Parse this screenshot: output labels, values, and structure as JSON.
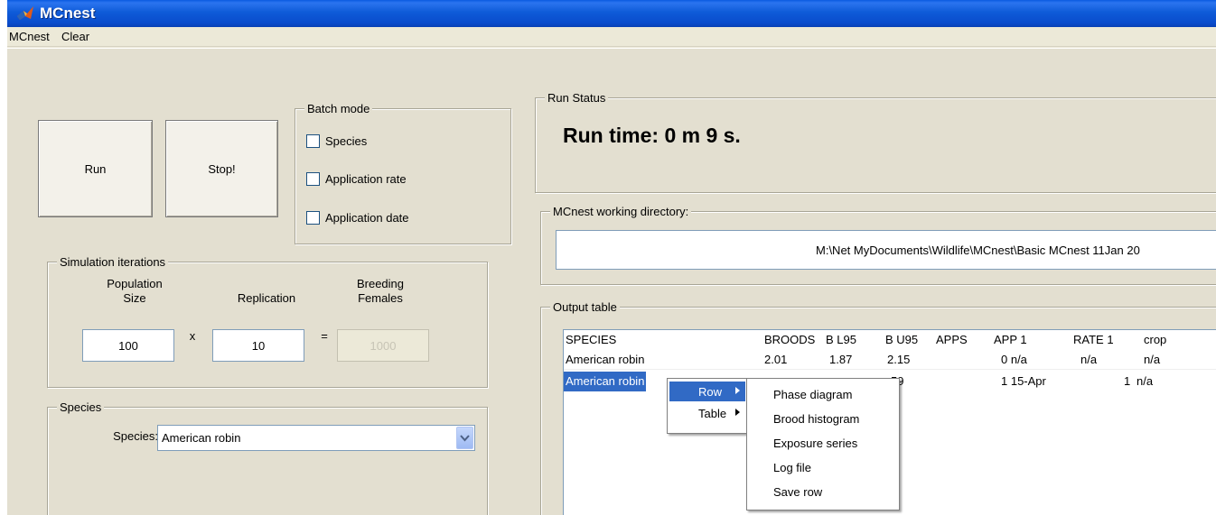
{
  "window": {
    "title": "MCnest"
  },
  "menu": [
    "MCnest",
    "Clear"
  ],
  "buttons": {
    "run": "Run",
    "stop": "Stop!"
  },
  "batch_mode": {
    "title": "Batch mode",
    "options": [
      {
        "label": "Species",
        "checked": false
      },
      {
        "label": "Application rate",
        "checked": false
      },
      {
        "label": "Application date",
        "checked": false
      }
    ]
  },
  "simulation": {
    "title": "Simulation iterations",
    "population_label": "Population\nSize",
    "population_label_lines": [
      "Population",
      "Size"
    ],
    "replication_label": "Replication",
    "breeding_label_lines": [
      "Breeding",
      "Females"
    ],
    "population_value": "100",
    "times_sign": "x",
    "replication_value": "10",
    "equals_sign": "=",
    "breeding_value": "1000"
  },
  "species_panel": {
    "title": "Species",
    "label": "Species:",
    "selected": "American robin"
  },
  "run_status": {
    "title": "Run Status",
    "text": "Run time: 0 m 9 s."
  },
  "working_dir": {
    "title": "MCnest working directory:",
    "path": "M:\\Net MyDocuments\\Wildlife\\MCnest\\Basic MCnest 11Jan 20"
  },
  "output_table": {
    "title": "Output table",
    "headers": [
      "SPECIES",
      "BROODS",
      "B L95",
      "B U95",
      "APPS",
      "APP 1",
      "RATE 1",
      "crop"
    ],
    "rows": [
      [
        "American robin",
        "2.01",
        "1.87",
        "2.15",
        "",
        "0 n/a",
        "n/a",
        "n/a"
      ],
      [
        "American robin",
        "",
        "",
        "59",
        "",
        "1 15-Apr",
        "1",
        "n/a"
      ]
    ]
  },
  "context_menu": {
    "items": [
      "Row",
      "Table"
    ],
    "submenu": [
      "Phase diagram",
      "Brood histogram",
      "Exposure series",
      "Log file",
      "Save row"
    ]
  },
  "colors": {
    "titlebar": "#0a4ccc",
    "selection": "#316ac5",
    "panel": "#e3dfd0"
  }
}
